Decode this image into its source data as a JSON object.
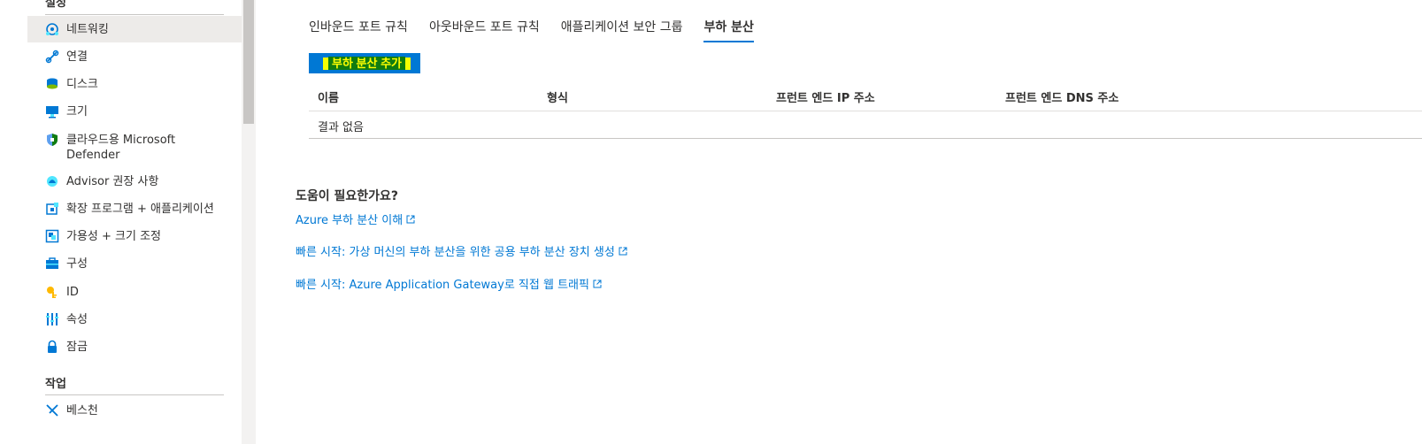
{
  "sidebar": {
    "top_section_partial": "설정",
    "items": [
      {
        "label": "네트워킹",
        "icon": "networking-icon",
        "active": true
      },
      {
        "label": "연결",
        "icon": "connect-icon"
      },
      {
        "label": "디스크",
        "icon": "disk-icon"
      },
      {
        "label": "크기",
        "icon": "size-icon"
      },
      {
        "label": "클라우드용 Microsoft",
        "label2": "Defender",
        "icon": "defender-icon"
      },
      {
        "label": "Advisor 권장 사항",
        "icon": "advisor-icon"
      },
      {
        "label": "확장 프로그램 + 애플리케이션",
        "icon": "extensions-icon"
      },
      {
        "label": "가용성 + 크기 조정",
        "icon": "availability-icon"
      },
      {
        "label": "구성",
        "icon": "configuration-icon"
      },
      {
        "label": "ID",
        "icon": "identity-icon"
      },
      {
        "label": "속성",
        "icon": "properties-icon"
      },
      {
        "label": "잠금",
        "icon": "lock-icon"
      }
    ],
    "section_ops": "작업",
    "ops_items": [
      {
        "label": "베스천",
        "icon": "bastion-icon"
      }
    ]
  },
  "tabs": [
    {
      "label": "인바운드 포트 규칙"
    },
    {
      "label": "아웃바운드 포트 규칙"
    },
    {
      "label": "애플리케이션 보안 그룹"
    },
    {
      "label": "부하 분산",
      "active": true
    }
  ],
  "add_button": {
    "label": "부하 분산 추가"
  },
  "table": {
    "headers": [
      "이름",
      "형식",
      "프런트 엔드 IP 주소",
      "프런트 엔드 DNS 주소"
    ],
    "empty_text": "결과 없음"
  },
  "help": {
    "title": "도움이 필요한가요?",
    "links": [
      "Azure 부하 분산 이해",
      "빠른 시작: 가상 머신의 부하 분산을 위한 공용 부하 분산 장치 생성",
      "빠른 시작: Azure Application Gateway로 직접 웹 트래픽"
    ]
  },
  "colors": {
    "accent": "#0078d4",
    "highlight": "#f5ff00"
  }
}
